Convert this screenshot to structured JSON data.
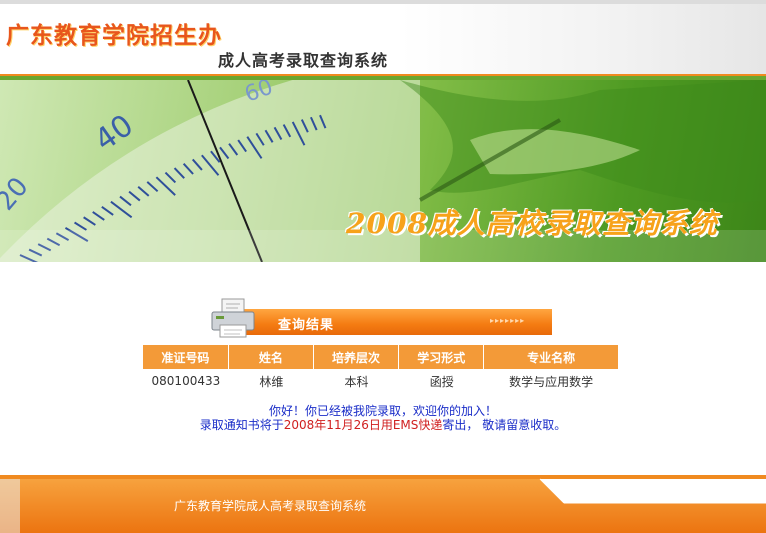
{
  "header": {
    "org_name": "广东教育学院招生办",
    "system_name": "成人高考录取查询系统"
  },
  "banner": {
    "title": "2008成人高校录取查询系统",
    "ruler_labels": [
      "20",
      "40",
      "60"
    ]
  },
  "result": {
    "section_title": "查询结果",
    "columns": [
      "准证号码",
      "姓名",
      "培养层次",
      "学习形式",
      "专业名称"
    ],
    "rows": [
      [
        "080100433",
        "林维",
        "本科",
        "函授",
        "数学与应用数学"
      ]
    ],
    "message_line1": "你好！你已经被我院录取，欢迎你的加入！",
    "message_line2_prefix": "录取通知书将于",
    "message_line2_highlight": "2008年11月26日用EMS快递",
    "message_line2_suffix": "寄出， 敬请留意收取。"
  },
  "footer": {
    "text": "广东教育学院成人高考录取查询系统"
  },
  "colors": {
    "accent_orange": "#f39a38",
    "brand_red": "#e8561c",
    "message_blue": "#1a2dc8",
    "highlight_red": "#d02020",
    "banner_green": "#7fbb45"
  }
}
